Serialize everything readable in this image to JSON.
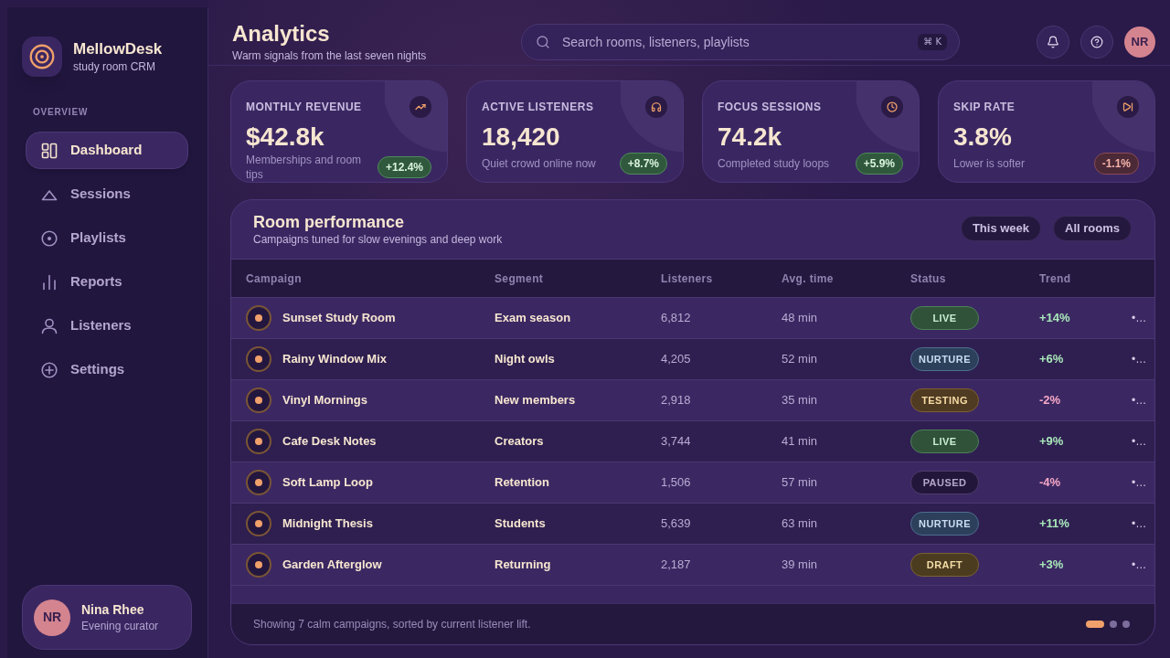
{
  "sidebar": {
    "brand": {
      "name": "MellowDesk",
      "tagline": "study room CRM"
    },
    "section_label": "OVERVIEW",
    "nav_items": [
      {
        "label": "Dashboard",
        "selected": true
      },
      {
        "label": "Sessions",
        "selected": false
      },
      {
        "label": "Playlists",
        "selected": false
      },
      {
        "label": "Reports",
        "selected": false
      },
      {
        "label": "Listeners",
        "selected": false
      },
      {
        "label": "Settings",
        "selected": false
      }
    ],
    "user": {
      "initials": "NR",
      "name": "Nina Rhee",
      "role": "Evening curator"
    }
  },
  "header": {
    "title": "Analytics",
    "subtitle": "Warm signals from the last seven nights",
    "search": {
      "placeholder": "Search rooms, listeners, playlists",
      "shortcut": "⌘ K"
    },
    "avatar_initials": "NR"
  },
  "kpi_cards": [
    {
      "label": "MONTHLY REVENUE",
      "value": "$42.8k",
      "note": "Memberships and room tips",
      "delta": {
        "value": "+12.4%",
        "kind": "up"
      }
    },
    {
      "label": "ACTIVE LISTENERS",
      "value": "18,420",
      "note": "Quiet crowd online now",
      "delta": {
        "value": "+8.7%",
        "kind": "up"
      }
    },
    {
      "label": "FOCUS SESSIONS",
      "value": "74.2k",
      "note": "Completed study loops",
      "delta": {
        "value": "+5.9%",
        "kind": "up"
      }
    },
    {
      "label": "SKIP RATE",
      "value": "3.8%",
      "note": "Lower is softer",
      "delta": {
        "value": "-1.1%",
        "kind": "down"
      }
    }
  ],
  "room_performance": {
    "title": "Room performance",
    "subtitle": "Campaigns tuned for slow evenings and deep work",
    "filters": [
      "This week",
      "All rooms"
    ],
    "table": {
      "columns": [
        "Campaign",
        "Segment",
        "Listeners",
        "Avg. time",
        "Status",
        "Trend"
      ],
      "rows": [
        {
          "campaign": "Sunset Study Room",
          "segment": "Exam season",
          "listeners": "6,812",
          "avg_time": "48 min",
          "status": {
            "label": "LIVE",
            "kind": "live"
          },
          "trend": {
            "value": "+14%",
            "kind": "up"
          },
          "column_7": "•…"
        },
        {
          "campaign": "Rainy Window Mix",
          "segment": "Night owls",
          "listeners": "4,205",
          "avg_time": "52 min",
          "status": {
            "label": "NURTURE",
            "kind": "nurture"
          },
          "trend": {
            "value": "+6%",
            "kind": "up"
          },
          "column_7": "•…"
        },
        {
          "campaign": "Vinyl Mornings",
          "segment": "New members",
          "listeners": "2,918",
          "avg_time": "35 min",
          "status": {
            "label": "TESTING",
            "kind": "testing"
          },
          "trend": {
            "value": "-2%",
            "kind": "down"
          },
          "column_7": "•…"
        },
        {
          "campaign": "Cafe Desk Notes",
          "segment": "Creators",
          "listeners": "3,744",
          "avg_time": "41 min",
          "status": {
            "label": "LIVE",
            "kind": "live"
          },
          "trend": {
            "value": "+9%",
            "kind": "up"
          },
          "column_7": "•…"
        },
        {
          "campaign": "Soft Lamp Loop",
          "segment": "Retention",
          "listeners": "1,506",
          "avg_time": "57 min",
          "status": {
            "label": "PAUSED",
            "kind": "paused"
          },
          "trend": {
            "value": "-4%",
            "kind": "down"
          },
          "column_7": "•…"
        },
        {
          "campaign": "Midnight Thesis",
          "segment": "Students",
          "listeners": "5,639",
          "avg_time": "63 min",
          "status": {
            "label": "NURTURE",
            "kind": "nurture"
          },
          "trend": {
            "value": "+11%",
            "kind": "up"
          },
          "column_7": "•…"
        },
        {
          "campaign": "Garden Afterglow",
          "segment": "Returning",
          "listeners": "2,187",
          "avg_time": "39 min",
          "status": {
            "label": "DRAFT",
            "kind": "draft"
          },
          "trend": {
            "value": "+3%",
            "kind": "up"
          },
          "column_7": "•…"
        }
      ]
    },
    "footer": {
      "summary": "Showing 7 calm campaigns, sorted by current listener lift.",
      "pages": [
        {
          "selected": true
        },
        {
          "selected": false
        },
        {
          "selected": false
        }
      ]
    }
  }
}
